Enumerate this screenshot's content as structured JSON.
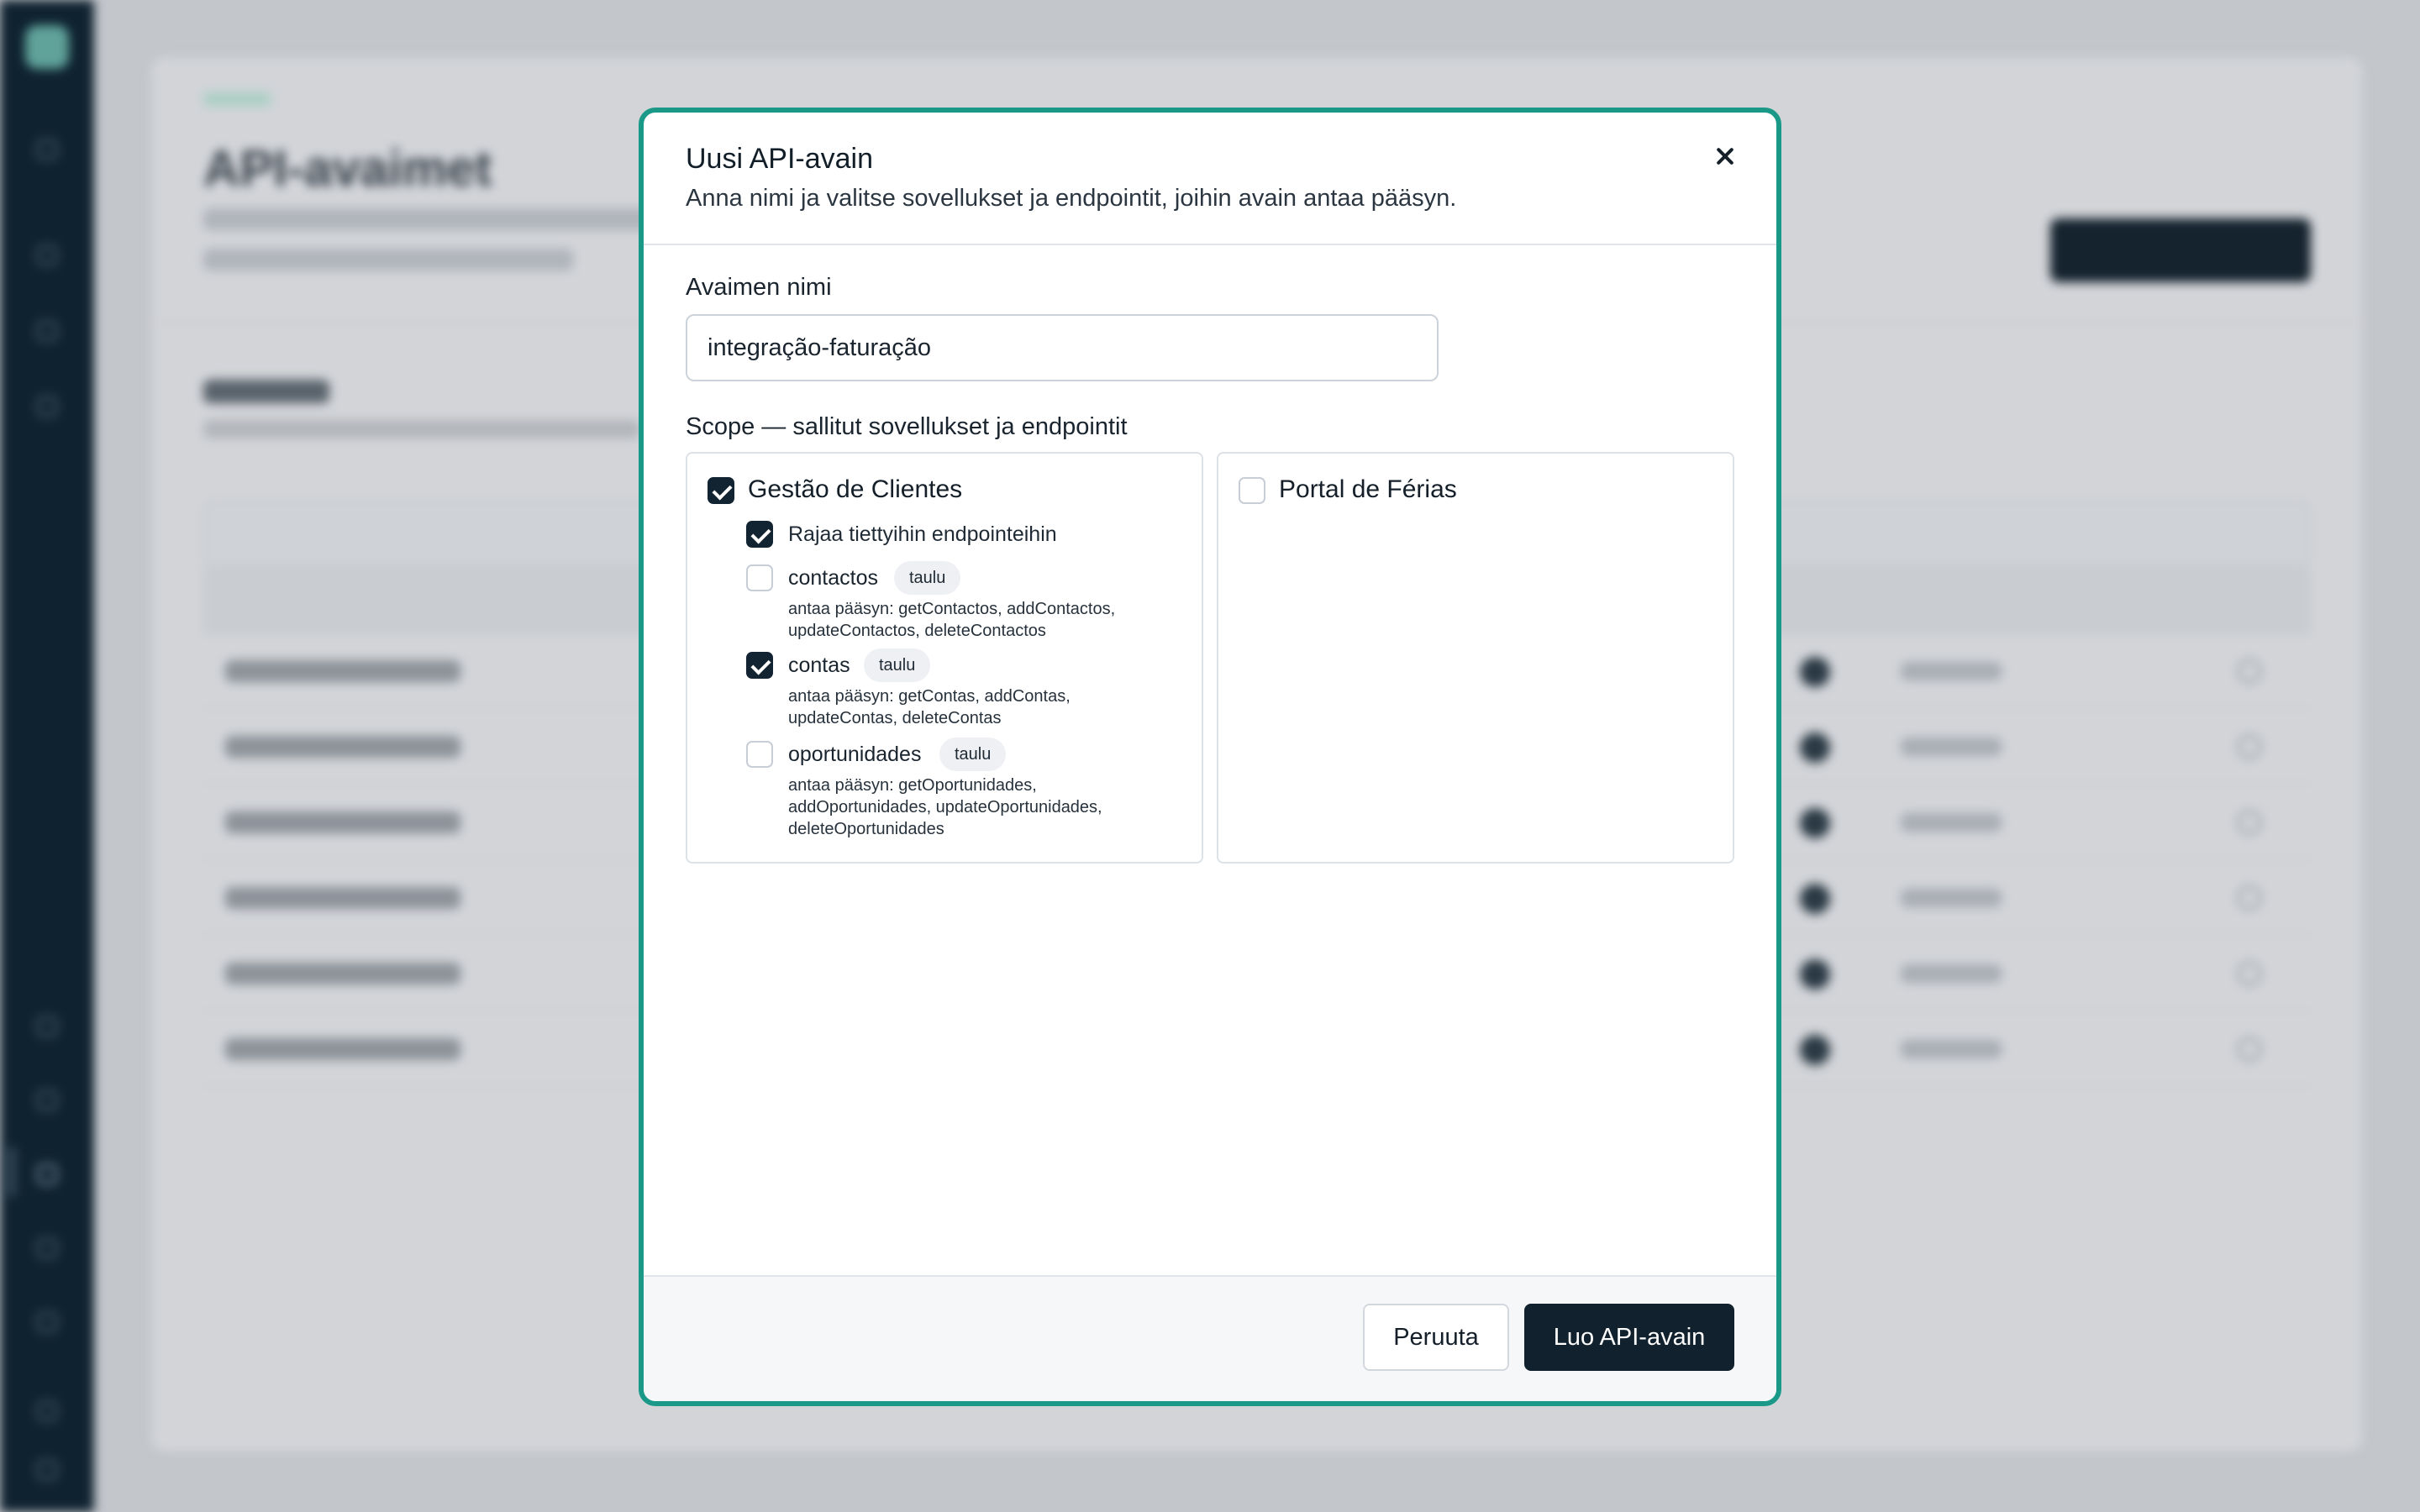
{
  "background": {
    "page_title": "API-avaimet"
  },
  "modal": {
    "title": "Uusi API-avain",
    "subtitle": "Anna nimi ja valitse sovellukset ja endpointit, joihin avain antaa pääsyn.",
    "close_icon": "close-icon",
    "key_name_label": "Avaimen nimi",
    "key_name_value": "integração-faturação",
    "scope_label": "Scope — sallitut sovellukset ja endpointit",
    "apps": [
      {
        "name": "Gestão de Clientes",
        "checked": true,
        "restrict_label": "Rajaa tiettyihin endpointeihin",
        "restrict_checked": true,
        "endpoints": [
          {
            "name": "contactos",
            "badge": "taulu",
            "checked": false,
            "desc_line1": "antaa pääsyn: getContactos, addContactos,",
            "desc_line2": "updateContactos, deleteContactos"
          },
          {
            "name": "contas",
            "badge": "taulu",
            "checked": true,
            "desc_line1": "antaa pääsyn: getContas, addContas,",
            "desc_line2": "updateContas, deleteContas"
          },
          {
            "name": "oportunidades",
            "badge": "taulu",
            "checked": false,
            "desc_line1": "antaa pääsyn: getOportunidades,",
            "desc_line2": "addOportunidades, updateOportunidades,",
            "desc_line3": "deleteOportunidades"
          }
        ]
      },
      {
        "name": "Portal de Férias",
        "checked": false
      }
    ],
    "cancel_label": "Peruuta",
    "create_label": "Luo API-avain",
    "accent_color": "#1a9988"
  }
}
